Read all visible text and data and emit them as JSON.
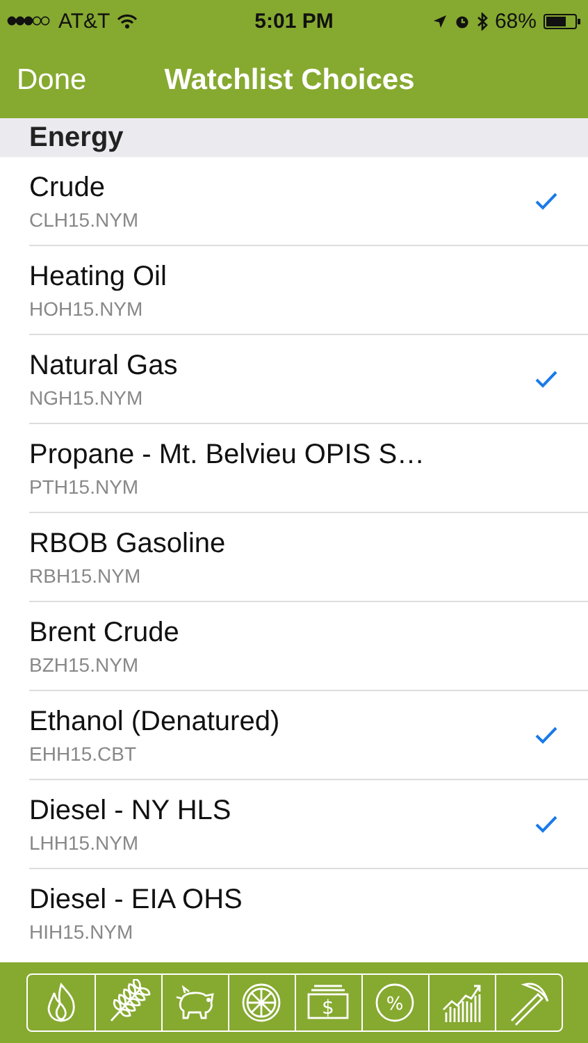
{
  "status_bar": {
    "carrier": "AT&T",
    "time": "5:01 PM",
    "battery": "68%"
  },
  "nav": {
    "done": "Done",
    "title": "Watchlist Choices"
  },
  "section": {
    "title": "Energy"
  },
  "rows": [
    {
      "name": "Crude",
      "code": "CLH15.NYM",
      "checked": true
    },
    {
      "name": "Heating Oil",
      "code": "HOH15.NYM",
      "checked": false
    },
    {
      "name": "Natural Gas",
      "code": "NGH15.NYM",
      "checked": true
    },
    {
      "name": "Propane - Mt. Belvieu OPIS S…",
      "code": "PTH15.NYM",
      "checked": false
    },
    {
      "name": "RBOB Gasoline",
      "code": "RBH15.NYM",
      "checked": false
    },
    {
      "name": "Brent Crude",
      "code": "BZH15.NYM",
      "checked": false
    },
    {
      "name": "Ethanol (Denatured)",
      "code": "EHH15.CBT",
      "checked": true
    },
    {
      "name": "Diesel - NY HLS",
      "code": "LHH15.NYM",
      "checked": true
    },
    {
      "name": "Diesel - EIA OHS",
      "code": "HIH15.NYM",
      "checked": false
    }
  ],
  "toolbar": [
    {
      "kind": "flame"
    },
    {
      "kind": "wheat"
    },
    {
      "kind": "pig"
    },
    {
      "kind": "citrus"
    },
    {
      "kind": "money",
      "symbol": "$"
    },
    {
      "kind": "percent",
      "symbol": "%"
    },
    {
      "kind": "chart"
    },
    {
      "kind": "pickaxe"
    }
  ]
}
